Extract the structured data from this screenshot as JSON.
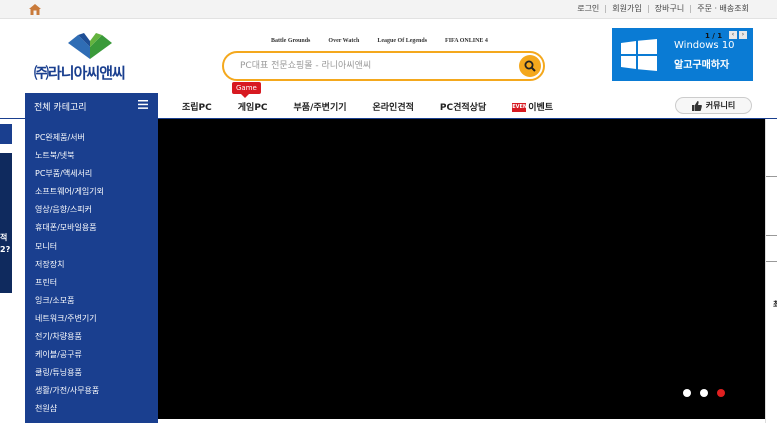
{
  "top_links": [
    "로그인",
    "회원가입",
    "장바구니",
    "주문 · 배송조회"
  ],
  "logo_text": "㈜라니아씨앤씨",
  "quick_links": [
    "Battle Grounds",
    "Over Watch",
    "League Of Legends",
    "FIFA ONLINE 4"
  ],
  "search": {
    "placeholder": "PC대표 전문쇼핑몰 - 라니아씨앤씨"
  },
  "win_banner": {
    "title": "Windows 10",
    "subtitle": "알고구매하자",
    "pager": "1 / 1"
  },
  "category_button": "전체 카테고리",
  "nav_items": [
    "조립PC",
    "게임PC",
    "부품/주변기기",
    "온라인견적",
    "PC견적상담",
    "이벤트"
  ],
  "game_badge": "Game",
  "event_icon_text": "EVENT",
  "community_label": "커뮤니티",
  "categories": [
    "PC완제품/서버",
    "노트북/넷북",
    "PC부품/액세서리",
    "소프트웨어/게임기외",
    "영상/음향/스피커",
    "휴대폰/모바일용품",
    "모니터",
    "저장장치",
    "프린터",
    "잉크/소모품",
    "네트워크/주변기기",
    "전기/차량용품",
    "케이블/공구류",
    "쿨링/튜닝용품",
    "생활/가전/사무용품",
    "천원샵"
  ],
  "left_edge_text": "적\n2?",
  "right_edge_text": "최",
  "carousel": {
    "total": 3,
    "active_index": 2
  },
  "colors": {
    "brand_blue": "#1a3f8f",
    "search_orange": "#f4a81d",
    "windows_blue": "#0a7bd4",
    "accent_red": "#d71921"
  }
}
